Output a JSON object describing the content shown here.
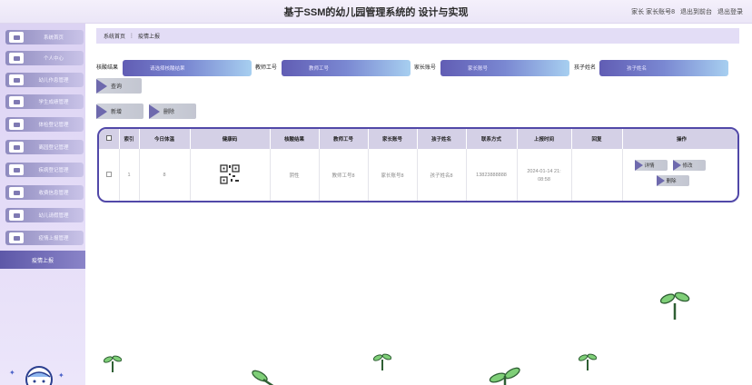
{
  "header": {
    "title": "基于SSM的幼儿园管理系统的 设计与实现",
    "user_role": "家长",
    "user_name": "家长账号8",
    "back_link": "退出到前台",
    "logout_link": "退出登录"
  },
  "sidebar": {
    "items": [
      {
        "label": "系统首页",
        "icon": "home-icon"
      },
      {
        "label": "个人中心",
        "icon": "user-icon"
      },
      {
        "label": "幼儿作息管理",
        "icon": "flag-icon"
      },
      {
        "label": "学生成绩管理",
        "icon": "book-icon"
      },
      {
        "label": "体检登记管理",
        "icon": "id-card-icon"
      },
      {
        "label": "离园登记管理",
        "icon": "document-icon"
      },
      {
        "label": "疾病登记管理",
        "icon": "grid-icon"
      },
      {
        "label": "收费信息管理",
        "icon": "monitor-icon"
      },
      {
        "label": "幼儿请假管理",
        "icon": "list-icon"
      },
      {
        "label": "疫情上报管理",
        "icon": "grid-icon"
      }
    ],
    "active_item": "疫情上报"
  },
  "breadcrumb": {
    "home": "系统首页",
    "separator": "⋮",
    "current": "疫情上报"
  },
  "search": {
    "fields": [
      {
        "label": "核酸结果",
        "placeholder": "请选择核酸结果"
      },
      {
        "label": "教师工号",
        "placeholder": "教师工号"
      },
      {
        "label": "家长账号",
        "placeholder": "家长账号"
      },
      {
        "label": "孩子姓名",
        "placeholder": "孩子姓名"
      }
    ],
    "query_button": "查询",
    "add_button": "新增",
    "delete_button": "删除"
  },
  "table": {
    "columns": [
      "",
      "索引",
      "今日体温",
      "健康码",
      "核酸结果",
      "教师工号",
      "家长账号",
      "孩子姓名",
      "联系方式",
      "上报时间",
      "回复",
      "操作"
    ],
    "rows": [
      {
        "index": "1",
        "temperature": "8",
        "health_code": "qr-code-icon",
        "nucleic_result": "阴性",
        "teacher_id": "教师工号8",
        "parent_account": "家长账号8",
        "child_name": "孩子姓名8",
        "phone": "13823888888",
        "report_time_line1": "2024-01-14 21:",
        "report_time_line2": "08:58",
        "reply": "",
        "actions": {
          "detail": "详情",
          "edit": "修改",
          "delete": "删除"
        }
      }
    ]
  },
  "colors": {
    "accent": "#5148a8",
    "sidebar_bg": "#dcd3f3",
    "button_triangle": "#6e69ad",
    "sprout": "#2f5f34"
  }
}
